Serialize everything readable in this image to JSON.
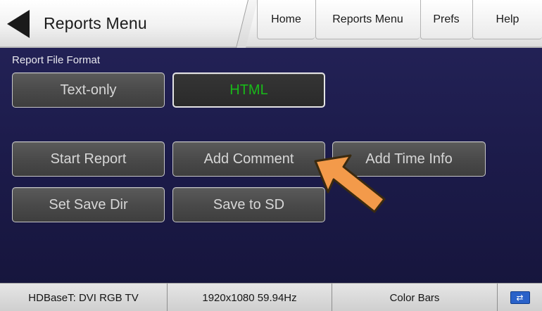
{
  "header": {
    "back_label": "Reports Menu",
    "tabs": [
      {
        "label": "Home"
      },
      {
        "label": "Reports Menu"
      },
      {
        "label": "Prefs"
      },
      {
        "label": "Help"
      }
    ]
  },
  "format": {
    "section_label": "Report File Format",
    "options": [
      {
        "label": "Text-only",
        "selected": false
      },
      {
        "label": "HTML",
        "selected": true
      }
    ]
  },
  "actions": {
    "start_report": "Start Report",
    "add_comment": "Add Comment",
    "add_time_info": "Add Time Info",
    "set_save_dir": "Set Save Dir",
    "save_to_sd": "Save to SD"
  },
  "status_bar": {
    "interface": "HDBaseT: DVI RGB TV",
    "resolution": "1920x1080 59.94Hz",
    "pattern": "Color Bars",
    "connection_icon": "usb-connection-icon"
  },
  "colors": {
    "selected_text": "#19b919",
    "pointer_arrow": "#f39a4a",
    "background": "#1f1e4e"
  }
}
